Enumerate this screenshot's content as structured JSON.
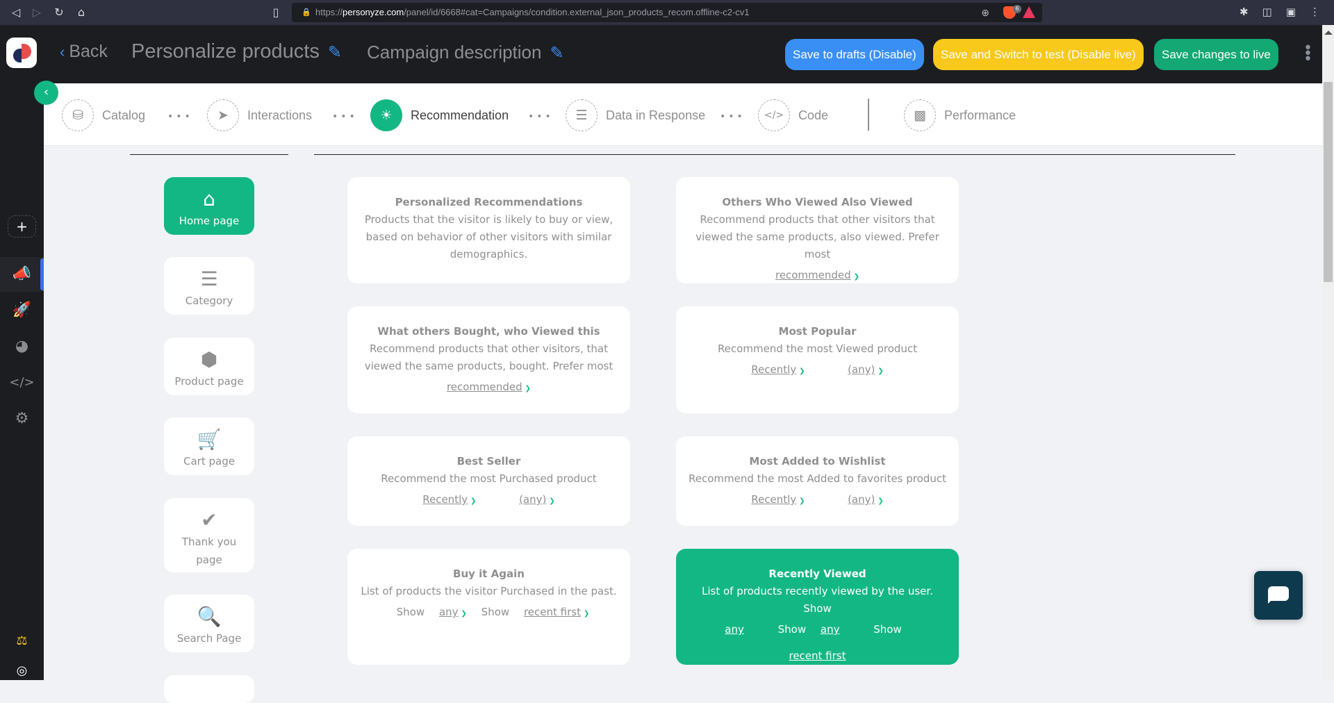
{
  "browser": {
    "url_prefix": "https://",
    "url_host": "personyze.com",
    "url_path": "/panel/id/6668#cat=Campaigns/condition.external_json_products_recom.offline-c2-cv1",
    "brave_badge": "6"
  },
  "header": {
    "back_label": "Back",
    "campaign_title": "Personalize products",
    "campaign_description": "Campaign description",
    "buttons": {
      "save_drafts": "Save to drafts (Disable)",
      "save_test": "Save and Switch to test (Disable live)",
      "save_live": "Save changes to live"
    },
    "colors": {
      "drafts": "#3a8ff5",
      "test": "#f8c81b",
      "live": "#13a874"
    }
  },
  "steps": [
    {
      "label": "Catalog",
      "icon": "database-icon",
      "active": false
    },
    {
      "label": "Interactions",
      "icon": "cursor-icon",
      "active": false
    },
    {
      "label": "Recommendation",
      "icon": "lightbulb-icon",
      "active": true
    },
    {
      "label": "Data in Response",
      "icon": "list-icon",
      "active": false
    },
    {
      "label": "Code",
      "icon": "code-icon",
      "active": false
    },
    {
      "label": "Performance",
      "icon": "bar-chart-icon",
      "active": false
    }
  ],
  "rail": {
    "add_label": "+",
    "items": [
      "megaphone-icon",
      "rocket-icon",
      "dashboard-icon",
      "code-icon",
      "gears-icon"
    ],
    "active_index": 0,
    "bottom": [
      "flask-icon",
      "lifebuoy-icon"
    ]
  },
  "page_types": [
    {
      "label": "Home page",
      "icon": "home-icon",
      "active": true
    },
    {
      "label": "Category",
      "icon": "list-bullets-icon",
      "active": false
    },
    {
      "label": "Product page",
      "icon": "cube-icon",
      "active": false
    },
    {
      "label": "Cart page",
      "icon": "cart-plus-icon",
      "active": false
    },
    {
      "label": "Thank you page",
      "icon": "check-icon",
      "active": false
    },
    {
      "label": "Search Page",
      "icon": "search-icon",
      "active": false
    }
  ],
  "recommendations": {
    "personalized": {
      "title": "Personalized Recommendations",
      "desc": "Products that the visitor is likely to buy or view, based on behavior of other visitors with similar demographics."
    },
    "others_viewed": {
      "title": "Others Who Viewed Also Viewed",
      "desc": "Recommend products that other visitors that viewed the same products, also viewed. Prefer most",
      "opt": "recommended"
    },
    "bought_viewed": {
      "title": "What others Bought, who Viewed this",
      "desc": "Recommend products that other visitors, that viewed the same products, bought. Prefer most",
      "opt": "recommended"
    },
    "most_popular": {
      "title": "Most Popular",
      "desc": "Recommend the most Viewed product",
      "opt1": "Recently",
      "opt2": "(any)"
    },
    "best_seller": {
      "title": "Best Seller",
      "desc": "Recommend the most Purchased product",
      "opt1": "Recently",
      "opt2": "(any)"
    },
    "wishlist": {
      "title": "Most Added to Wishlist",
      "desc": "Recommend the most Added to favorites product",
      "opt1": "Recently",
      "opt2": "(any)"
    },
    "buy_again": {
      "title": "Buy it Again",
      "desc": "List of products the visitor Purchased in the past.",
      "show1": "Show",
      "opt1": "any",
      "show2": "Show",
      "opt2": "recent first"
    },
    "recently_viewed": {
      "title": "Recently Viewed",
      "desc": "List of products recently viewed by the user. Show",
      "opt1": "any",
      "show1": "Show",
      "opt2": "any",
      "show2": "Show",
      "opt3": "recent first",
      "selected": true
    }
  },
  "colors": {
    "accent": "#13b783",
    "background": "#f1f2f6",
    "dark": "#1c1d20"
  }
}
